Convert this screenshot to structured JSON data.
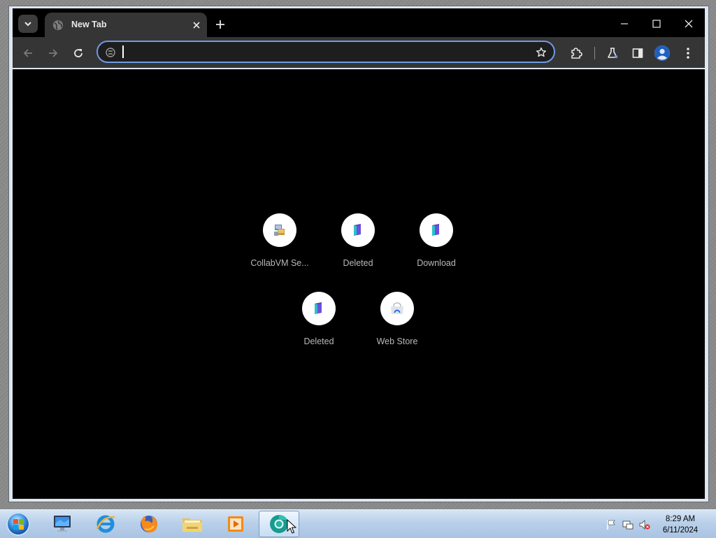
{
  "browser": {
    "tab": {
      "title": "New Tab"
    },
    "omnibox": {
      "value": "",
      "placeholder": ""
    }
  },
  "new_tab_page": {
    "shortcuts": [
      {
        "label": "CollabVM Se...",
        "icon": "collabvm-icon"
      },
      {
        "label": "Deleted",
        "icon": "purple-bookmark-icon"
      },
      {
        "label": "Download",
        "icon": "purple-bookmark-icon"
      },
      {
        "label": "Deleted",
        "icon": "purple-bookmark-icon"
      },
      {
        "label": "Web Store",
        "icon": "chrome-web-store-icon"
      }
    ]
  },
  "taskbar": {
    "apps": [
      {
        "name": "Computer",
        "icon": "monitor-icon"
      },
      {
        "name": "Internet Explorer",
        "icon": "internet-explorer-icon"
      },
      {
        "name": "Firefox",
        "icon": "firefox-icon"
      },
      {
        "name": "Windows Explorer",
        "icon": "folder-icon"
      },
      {
        "name": "Media Player",
        "icon": "media-player-icon"
      },
      {
        "name": "Chrome",
        "icon": "chrome-icon",
        "active": true
      }
    ],
    "clock": {
      "time": "8:29 AM",
      "date": "6/11/2024"
    }
  },
  "colors": {
    "page_background": "#000000",
    "toolbar": "#353535",
    "omnibox_focus_ring": "#6f9ae6",
    "shortcut_label": "#b9b9b9",
    "taskbar": "#b9d0ea"
  }
}
